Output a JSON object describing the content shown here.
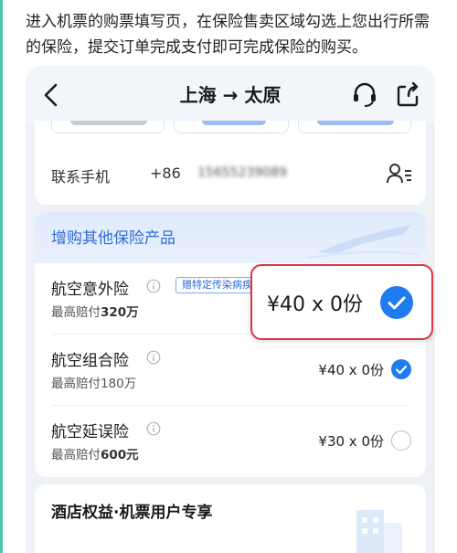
{
  "caption": "进入机票的购票填写页，在保险售卖区域勾选上您出行所需的保险，提交订单完成支付即可完成保险的购买。",
  "nav": {
    "route": "上海 → 太原"
  },
  "contact": {
    "label": "联系手机",
    "country_code": "+86",
    "phone_masked": "15655239089"
  },
  "insurance": {
    "section_title": "增购其他保险产品",
    "items": [
      {
        "name": "航空意外险",
        "tag": "赠特定传染病疾",
        "payout_prefix": "最高赔付",
        "payout_amount": "320万",
        "price": "¥40 x 0份",
        "selected": true
      },
      {
        "name": "航空组合险",
        "payout_prefix": "最高赔付",
        "payout_amount": "180万",
        "price": "¥40 x 0份",
        "selected": true
      },
      {
        "name": "航空延误险",
        "payout_prefix": "最高赔付",
        "payout_amount": "600元",
        "price": "¥30 x 0份",
        "selected": false
      }
    ]
  },
  "hotel": {
    "title": "酒店权益·机票用户专享"
  },
  "callout": {
    "price": "¥40 x 0份"
  },
  "colors": {
    "accent_blue": "#1f7bf0",
    "section_title_blue": "#2f6bd6",
    "highlight_red": "#d9363e"
  }
}
